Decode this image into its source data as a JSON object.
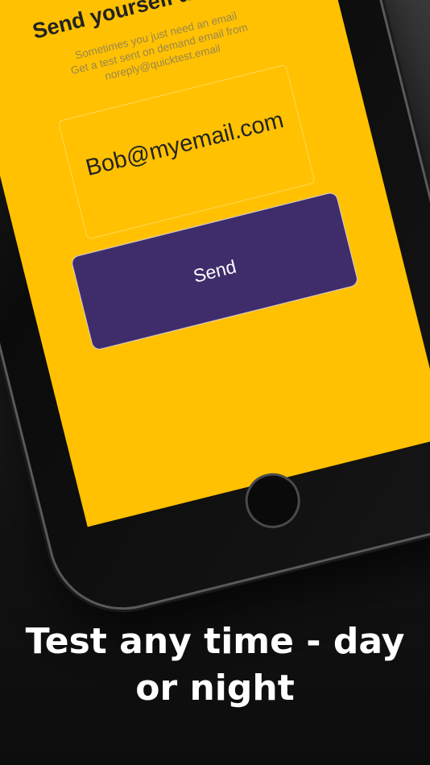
{
  "colors": {
    "screen_background": "#FFC101",
    "accent_purple": "#3f2d6b",
    "caption_text": "#ffffff",
    "page_background": "#111111"
  },
  "app": {
    "logo_icon": "envelope-icon",
    "title": "Send yourself an email",
    "subtitle_lines": [
      "Sometimes you just need an email",
      "Get a test sent on demand email from",
      "noreply@quicktest.email"
    ],
    "email_value": "Bob@myemail.com",
    "send_label": "Send"
  },
  "caption": {
    "line1": "Test any time - day",
    "line2": "or night"
  }
}
